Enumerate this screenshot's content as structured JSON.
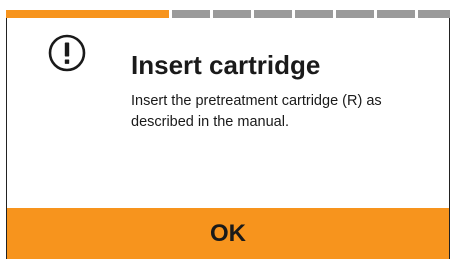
{
  "progress": {
    "total_steps": 9,
    "current_step": 1,
    "active_color": "#f7941d",
    "inactive_color": "#9a9a9a"
  },
  "dialog": {
    "icon": "alert-icon",
    "title": "Insert cartridge",
    "message": "Insert the pretreatment cartridge (R) as described in the manual."
  },
  "button": {
    "label": "OK",
    "color": "#f7941d"
  }
}
